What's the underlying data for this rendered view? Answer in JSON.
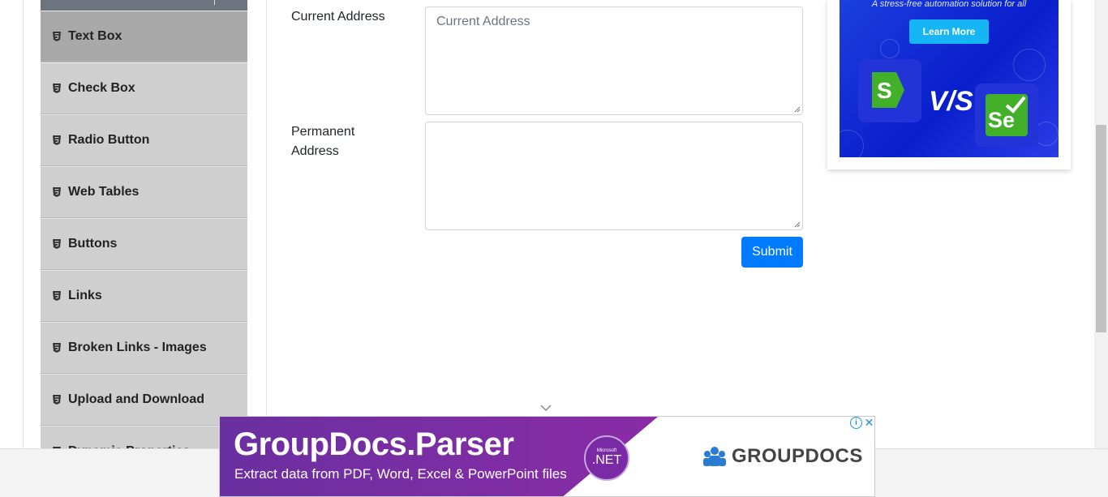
{
  "sidebar": {
    "items": [
      {
        "label": "Text Box",
        "active": true
      },
      {
        "label": "Check Box"
      },
      {
        "label": "Radio Button"
      },
      {
        "label": "Web Tables"
      },
      {
        "label": "Buttons"
      },
      {
        "label": "Links"
      },
      {
        "label": "Broken Links - Images"
      },
      {
        "label": "Upload and Download"
      },
      {
        "label": "Dynamic Properties"
      }
    ],
    "item_icon": "html5-icon"
  },
  "form": {
    "current_address_label": "Current Address",
    "current_address_placeholder": "Current Address",
    "current_address_value": "",
    "permanent_address_label_line1": "Permanent",
    "permanent_address_label_line2": "Address",
    "permanent_address_value": "",
    "submit_label": "Submit"
  },
  "side_ad": {
    "tagline": "A stress-free automation solution for all",
    "button_label": "Learn More",
    "vs_text": "V/S",
    "logo_left_letter": "S",
    "logo_right_text": "Se"
  },
  "banner_ad": {
    "title": "GroupDocs.Parser",
    "subtitle": "Extract data from PDF, Word, Excel & PowerPoint files",
    "badge_small": "Microsoft",
    "badge_main": ".NET",
    "brand": "GROUPDOCS",
    "info_icon": "info-icon",
    "close_icon": "close-icon"
  },
  "colors": {
    "primary": "#007bff",
    "sidebar_item": "#cfcfcf",
    "sidebar_active": "#a9a9a9",
    "banner_purple": "#7a2aa5"
  }
}
